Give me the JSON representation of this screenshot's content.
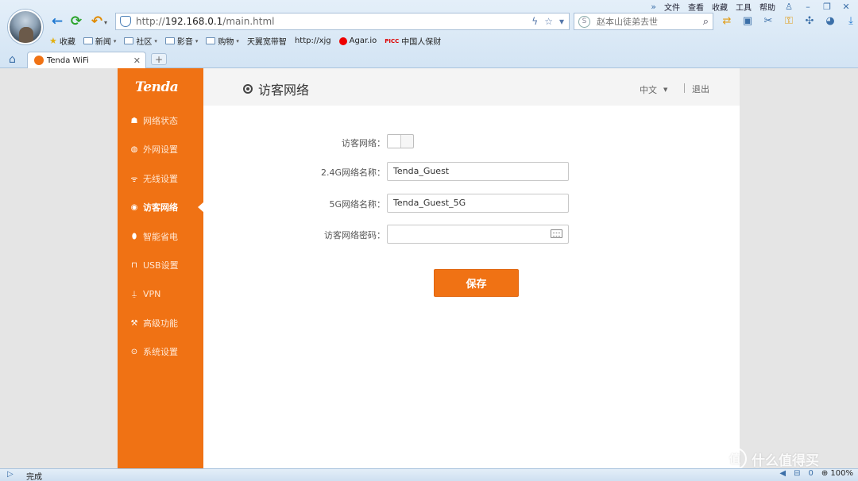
{
  "browser": {
    "menu": [
      "文件",
      "查看",
      "收藏",
      "工具",
      "帮助"
    ],
    "url_prefix": "http://",
    "url_host": "192.168.0.1",
    "url_path": "/main.html",
    "search_placeholder": "赵本山徒弟去世",
    "bookmarks": [
      {
        "label": "收藏",
        "icon": "star-icon"
      },
      {
        "label": "新闻",
        "icon": "folder-icon"
      },
      {
        "label": "社区",
        "icon": "folder-icon"
      },
      {
        "label": "影音",
        "icon": "folder-icon"
      },
      {
        "label": "购物",
        "icon": "folder-icon"
      },
      {
        "label": "天翼宽带智",
        "icon": "page-icon"
      },
      {
        "label": "http://xjg",
        "icon": "page-icon"
      },
      {
        "label": "Agar.io",
        "icon": "dot-icon"
      },
      {
        "label": "中国人保财",
        "icon": "picc-icon"
      }
    ],
    "tab_title": "Tenda WiFi",
    "status_text": "完成",
    "zoom": "100%",
    "status_count": "0"
  },
  "sidebar": {
    "logo": "Tenda",
    "items": [
      {
        "label": "网络状态",
        "icon": "network-status-icon",
        "glyph": "☗"
      },
      {
        "label": "外网设置",
        "icon": "globe-icon",
        "glyph": "◍"
      },
      {
        "label": "无线设置",
        "icon": "wifi-icon",
        "glyph": "ᯤ"
      },
      {
        "label": "访客网络",
        "icon": "guest-network-icon",
        "glyph": "◉",
        "active": true
      },
      {
        "label": "智能省电",
        "icon": "power-save-icon",
        "glyph": "⬮"
      },
      {
        "label": "USB设置",
        "icon": "usb-icon",
        "glyph": "⊓"
      },
      {
        "label": "VPN",
        "icon": "vpn-icon",
        "glyph": "⍊"
      },
      {
        "label": "高级功能",
        "icon": "wrench-icon",
        "glyph": "⚒"
      },
      {
        "label": "系统设置",
        "icon": "settings-icon",
        "glyph": "⊙"
      }
    ]
  },
  "header": {
    "title": "访客网络",
    "language": "中文",
    "logout": "退出"
  },
  "form": {
    "guest_label": "访客网络：",
    "guest_enabled": false,
    "ssid24_label": "2.4G网络名称：",
    "ssid24_value": "Tenda_Guest",
    "ssid5_label": "5G网络名称：",
    "ssid5_value": "Tenda_Guest_5G",
    "password_label": "访客网络密码：",
    "password_value": "",
    "save_label": "保存"
  },
  "watermark": "什么值得买",
  "colors": {
    "brand": "#f07214",
    "sidebar_text": "#ffe6d2"
  }
}
